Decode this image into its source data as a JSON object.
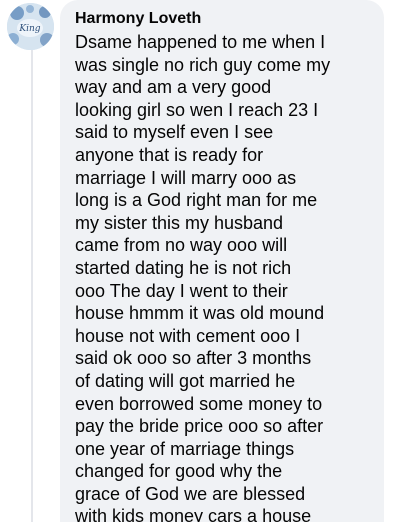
{
  "comment": {
    "author": "Harmony Loveth",
    "avatar_icon": "profile-photo-icon",
    "avatar_text": "King",
    "text": "Dsame happened to me  when I\nwas single no rich guy come my\nway  and am a very good\nlooking girl so wen I reach 23 I\nsaid to myself even I see\nanyone that is ready for\nmarriage I will marry ooo as\nlong is a God right man for me\nmy sister this my husband\ncame from no way ooo will\nstarted dating  he is not rich\nooo  The day I went to their\nhouse hmmm it was old mound\nhouse not with cement ooo I\nsaid ok ooo so after 3 months\nof dating will got married he\neven borrowed some money to\npay the bride price ooo so after\none year of marriage things\nchanged for good why the\ngrace of God we are blessed\nwith kids  money  cars  a house"
  },
  "colors": {
    "bubble": "#f0f2f5",
    "text": "#050505",
    "thread_line": "#e4e6eb"
  }
}
